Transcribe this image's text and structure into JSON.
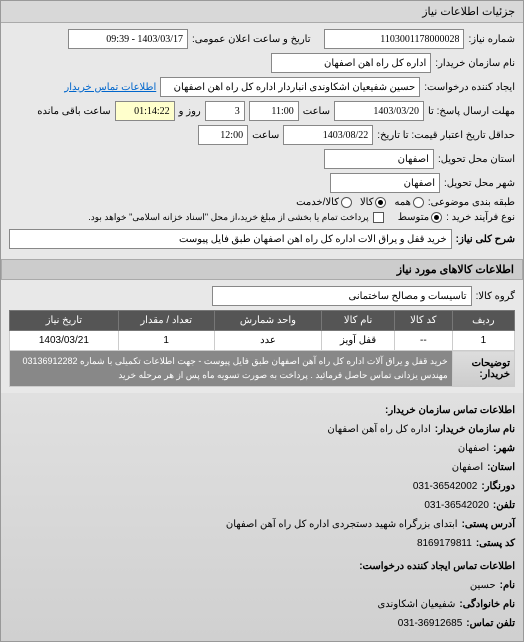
{
  "tab": {
    "title": "جزئیات اطلاعات نیاز"
  },
  "header": {
    "request_number_label": "شماره نیاز:",
    "request_number": "1103001178000028",
    "announce_label": "تاریخ و ساعت اعلان عمومی:",
    "announce_value": "1403/03/17 - 09:39",
    "buyer_label": "نام سازمان خریدار:",
    "buyer_value": "اداره کل راه آهن اصفهان",
    "creator_label": "ایجاد کننده درخواست:",
    "creator_value": "حسین شفیعیان اشکاوندی انباردار اداره کل راه آهن اصفهان",
    "contact_link": "اطلاعات تماس خریدار",
    "deadline_send_label": "مهلت ارسال پاسخ: تا",
    "deadline_send_date": "1403/03/20",
    "hour_label": "ساعت",
    "deadline_send_time": "11:00",
    "days_label": "روز و",
    "days_value": "3",
    "remain_time": "01:14:22",
    "remain_label": "ساعت باقی مانده",
    "valid_until_label": "حداقل تاریخ اعتبار قیمت: تا تاریخ:",
    "valid_until_date": "1403/08/22",
    "valid_until_time": "12:00",
    "delivery_province_label": "استان محل تحویل:",
    "delivery_province": "اصفهان",
    "delivery_city_label": "شهر محل تحویل:",
    "delivery_city": "اصفهان",
    "subject_group_label": "طبقه بندی موضوعی:",
    "subject_all": "همه",
    "subject_goods": "کالا",
    "subject_service": "کالا/خدمت",
    "process_type_label": "نوع فرآیند خرید :",
    "process_medium": "متوسط",
    "process_note": "پرداخت تمام یا بخشی از مبلغ خرید،از محل \"اسناد خزانه اسلامی\" خواهد بود.",
    "summary_label": "شرح کلی نیاز:",
    "summary_value": "خرید قفل و یراق آلات اداره کل راه آهن اصفهان طبق فایل پیوست"
  },
  "goods": {
    "section_title": "اطلاعات کالاهای مورد نیاز",
    "group_label": "گروه کالا:",
    "group_value": "تاسیسات و مصالح ساختمانی",
    "columns": {
      "row": "ردیف",
      "code": "کد کالا",
      "name": "نام کالا",
      "unit": "واحد شمارش",
      "qty": "تعداد / مقدار",
      "date": "تاریخ نیاز"
    },
    "rows": [
      {
        "row": "1",
        "code": "--",
        "name": "قفل آویز",
        "unit": "عدد",
        "qty": "1",
        "date": "1403/03/21"
      }
    ],
    "desc_label": "توضیحات خریدار:",
    "desc_value": "خرید قفل و یراق آلات اداره کل راه آهن اصفهان طبق فایل پیوست - جهت اطلاعات تکمیلی با شماره 03136912282 مهندس یزدانی تماس حاصل فرمائید . پرداخت به صورت تسویه ماه پس از هر مرحله خرید"
  },
  "contact": {
    "section_title": "اطلاعات تماس سازمان خریدار:",
    "org_label": "نام سازمان خریدار:",
    "org_value": "اداره کل راه آهن اصفهان",
    "city_label": "شهر:",
    "city_value": "اصفهان",
    "province_label": "استان:",
    "province_value": "اصفهان",
    "fax_label": "دورنگار:",
    "fax_value": "031-36542002",
    "phone_label": "تلفن:",
    "phone_value": "031-36542020",
    "address_label": "آدرس پستی:",
    "address_value": "ابتدای بزرگراه شهید دستجردی اداره کل راه آهن اصفهان",
    "postcode_label": "کد پستی:",
    "postcode_value": "8169179811",
    "creator_section": "اطلاعات تماس ایجاد کننده درخواست:",
    "name_label": "نام:",
    "name_value": "حسین",
    "family_label": "نام خانوادگی:",
    "family_value": "شفیعیان اشکاوندی",
    "tel_label": "تلفن تماس:",
    "tel_value": "031-36912685"
  }
}
